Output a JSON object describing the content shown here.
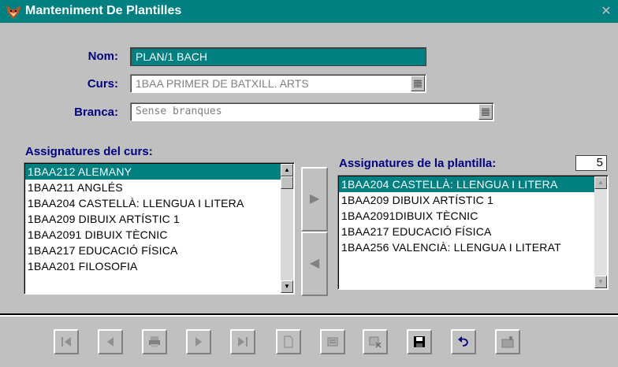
{
  "window": {
    "title": "Manteniment De Plantilles",
    "close_icon": "close-icon"
  },
  "form": {
    "nom": {
      "label": "Nom:",
      "value": "PLAN/1 BACH"
    },
    "curs": {
      "label": "Curs:",
      "value": "1BAA PRIMER DE BATXILL. ARTS"
    },
    "branca": {
      "label": "Branca:",
      "value": "Sense branques"
    }
  },
  "course_subjects": {
    "label": "Assignatures del curs:",
    "items": [
      "1BAA212  ALEMANY",
      "1BAA211  ANGLÉS",
      "1BAA204  CASTELLÀ: LLENGUA I LITERA",
      "1BAA209  DIBUIX ARTÍSTIC 1",
      "1BAA2091  DIBUIX TÈCNIC",
      "1BAA217  EDUCACIÓ FÍSICA",
      "1BAA201  FILOSOFIA"
    ],
    "selected_index": 0
  },
  "template_subjects": {
    "label": "Assignatures de la plantilla:",
    "count": "5",
    "items": [
      "1BAA204 CASTELLÀ: LLENGUA I LITERA",
      "1BAA209 DIBUIX ARTÍSTIC 1",
      "1BAA2091DIBUIX TÈCNIC",
      "1BAA217 EDUCACIÓ FÍSICA",
      "1BAA256 VALENCIÀ: LLENGUA I LITERAT"
    ],
    "selected_index": 0
  },
  "move_buttons": [
    "move-right-icon",
    "move-left-icon"
  ],
  "toolbar": [
    "first-record-icon",
    "previous-record-icon",
    "print-icon",
    "next-record-icon",
    "last-record-icon",
    "new-record-icon",
    "edit-icon",
    "delete-icon",
    "save-icon",
    "undo-icon",
    "search-icon"
  ],
  "colors": {
    "title_bar": "#008080",
    "label": "#000080",
    "selection": "#008080",
    "window": "#c0c0c0"
  }
}
